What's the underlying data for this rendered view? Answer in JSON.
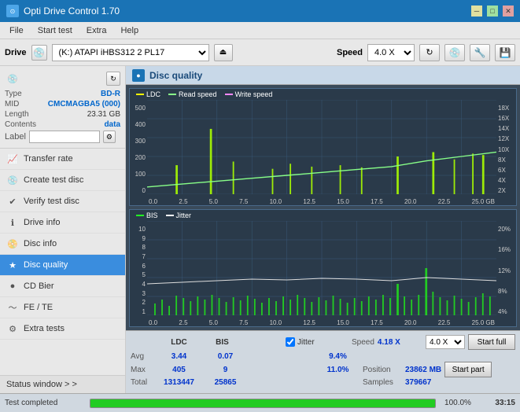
{
  "titlebar": {
    "title": "Opti Drive Control 1.70",
    "icon": "⊙",
    "controls": {
      "min": "─",
      "max": "□",
      "close": "✕"
    }
  },
  "menubar": {
    "items": [
      "File",
      "Start test",
      "Extra",
      "Help"
    ]
  },
  "toolbar": {
    "drive_label": "Drive",
    "drive_value": "(K:) ATAPI iHBS312  2 PL17",
    "speed_label": "Speed",
    "speed_value": "4.0 X",
    "eject_icon": "⏏",
    "refresh_icon": "↻"
  },
  "sidebar": {
    "disc_section": {
      "type_label": "Type",
      "type_value": "BD-R",
      "mid_label": "MID",
      "mid_value": "CMCMAGBA5 (000)",
      "length_label": "Length",
      "length_value": "23.31 GB",
      "contents_label": "Contents",
      "contents_value": "data",
      "label_label": "Label",
      "label_value": ""
    },
    "nav_items": [
      {
        "id": "transfer-rate",
        "label": "Transfer rate",
        "icon": "📈"
      },
      {
        "id": "create-test-disc",
        "label": "Create test disc",
        "icon": "💿"
      },
      {
        "id": "verify-test-disc",
        "label": "Verify test disc",
        "icon": "✔"
      },
      {
        "id": "drive-info",
        "label": "Drive info",
        "icon": "ℹ"
      },
      {
        "id": "disc-info",
        "label": "Disc info",
        "icon": "📀"
      },
      {
        "id": "disc-quality",
        "label": "Disc quality",
        "icon": "★",
        "active": true
      },
      {
        "id": "cd-bier",
        "label": "CD Bier",
        "icon": "🍺"
      },
      {
        "id": "fe-te",
        "label": "FE / TE",
        "icon": "〜"
      },
      {
        "id": "extra-tests",
        "label": "Extra tests",
        "icon": "⚙"
      }
    ],
    "status_window": "Status window > >"
  },
  "disc_quality": {
    "title": "Disc quality",
    "icon": "●",
    "chart1": {
      "legend": [
        {
          "id": "ldc",
          "label": "LDC",
          "color": "#ffff00"
        },
        {
          "id": "read-speed",
          "label": "Read speed",
          "color": "#88ff88"
        },
        {
          "id": "write-speed",
          "label": "Write speed",
          "color": "#ff88ff"
        }
      ],
      "y_left": [
        "500",
        "400",
        "300",
        "200",
        "100",
        "0"
      ],
      "y_right": [
        "18X",
        "16X",
        "14X",
        "12X",
        "10X",
        "8X",
        "6X",
        "4X",
        "2X"
      ],
      "x_labels": [
        "0.0",
        "2.5",
        "5.0",
        "7.5",
        "10.0",
        "12.5",
        "15.0",
        "17.5",
        "20.0",
        "22.5",
        "25.0 GB"
      ]
    },
    "chart2": {
      "legend": [
        {
          "id": "bis",
          "label": "BIS",
          "color": "#22ff22"
        },
        {
          "id": "jitter",
          "label": "Jitter",
          "color": "#ffffff"
        }
      ],
      "y_left": [
        "10",
        "9",
        "8",
        "7",
        "6",
        "5",
        "4",
        "3",
        "2",
        "1"
      ],
      "y_right": [
        "20%",
        "16%",
        "12%",
        "8%",
        "4%"
      ],
      "x_labels": [
        "0.0",
        "2.5",
        "5.0",
        "7.5",
        "10.0",
        "12.5",
        "15.0",
        "17.5",
        "20.0",
        "22.5",
        "25.0 GB"
      ]
    }
  },
  "stats": {
    "headers": {
      "ldc": "LDC",
      "bis": "BIS",
      "jitter": "Jitter",
      "speed": "Speed",
      "position": "Position"
    },
    "jitter_checked": true,
    "jitter_label": "Jitter",
    "speed_val": "4.18 X",
    "speed_select": "4.0 X",
    "rows": [
      {
        "label": "Avg",
        "ldc": "3.44",
        "bis": "0.07",
        "jitter": "9.4%"
      },
      {
        "label": "Max",
        "ldc": "405",
        "bis": "9",
        "jitter": "11.0%",
        "position_label": "Position",
        "position_val": "23862 MB"
      },
      {
        "label": "Total",
        "ldc": "1313447",
        "bis": "25865",
        "samples_label": "Samples",
        "samples_val": "379667"
      }
    ],
    "start_full": "Start full",
    "start_part": "Start part"
  },
  "statusbar": {
    "status_text": "Test completed",
    "progress": 100,
    "progress_text": "100.0%",
    "time": "33:15"
  }
}
